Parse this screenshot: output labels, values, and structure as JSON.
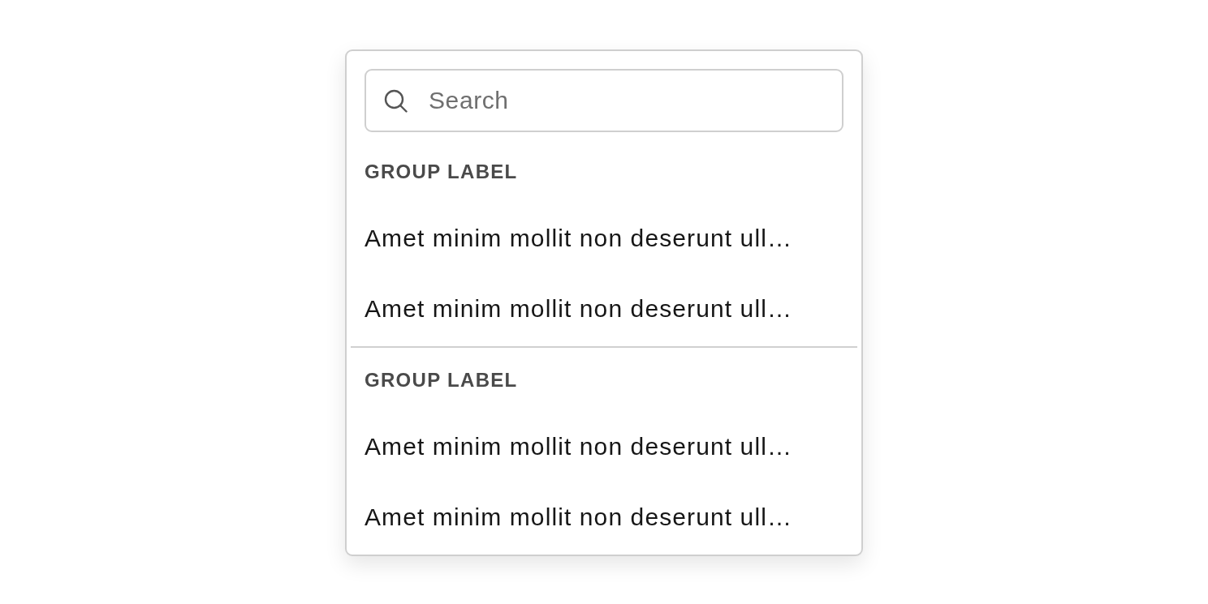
{
  "search": {
    "placeholder": "Search"
  },
  "groups": [
    {
      "label": "GROUP LABEL",
      "items": [
        {
          "label": "Amet minim mollit non deserunt ull…",
          "selected": false
        },
        {
          "label": "Amet minim mollit non deserunt ull…",
          "selected": false
        }
      ]
    },
    {
      "label": "GROUP LABEL",
      "items": [
        {
          "label": "Amet minim mollit non deserunt ull…",
          "selected": false
        },
        {
          "label": "Amet minim mollit non deserunt ull…",
          "selected": false
        }
      ]
    }
  ]
}
